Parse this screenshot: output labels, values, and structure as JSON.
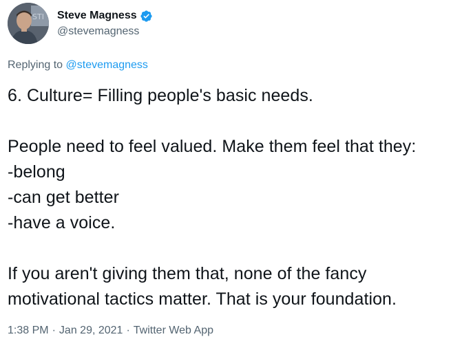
{
  "author": {
    "display_name": "Steve Magness",
    "handle": "@stevemagness",
    "verified": true,
    "avatar_icon": "profile-photo"
  },
  "reply": {
    "prefix": "Replying to ",
    "mention": "@stevemagness"
  },
  "tweet": {
    "text": "6. Culture= Filling people's basic needs.\n\nPeople need to feel valued. Make them feel that they:\n-belong\n-can get better\n-have a voice.\n\nIf you aren't giving them that, none of the fancy\nmotivational tactics matter. That is your foundation."
  },
  "meta": {
    "time": "1:38 PM",
    "separator": "·",
    "date": "Jan 29, 2021",
    "source": "Twitter Web App"
  },
  "colors": {
    "text": "#0f1419",
    "secondary": "#536471",
    "accent": "#1d9bf0"
  }
}
